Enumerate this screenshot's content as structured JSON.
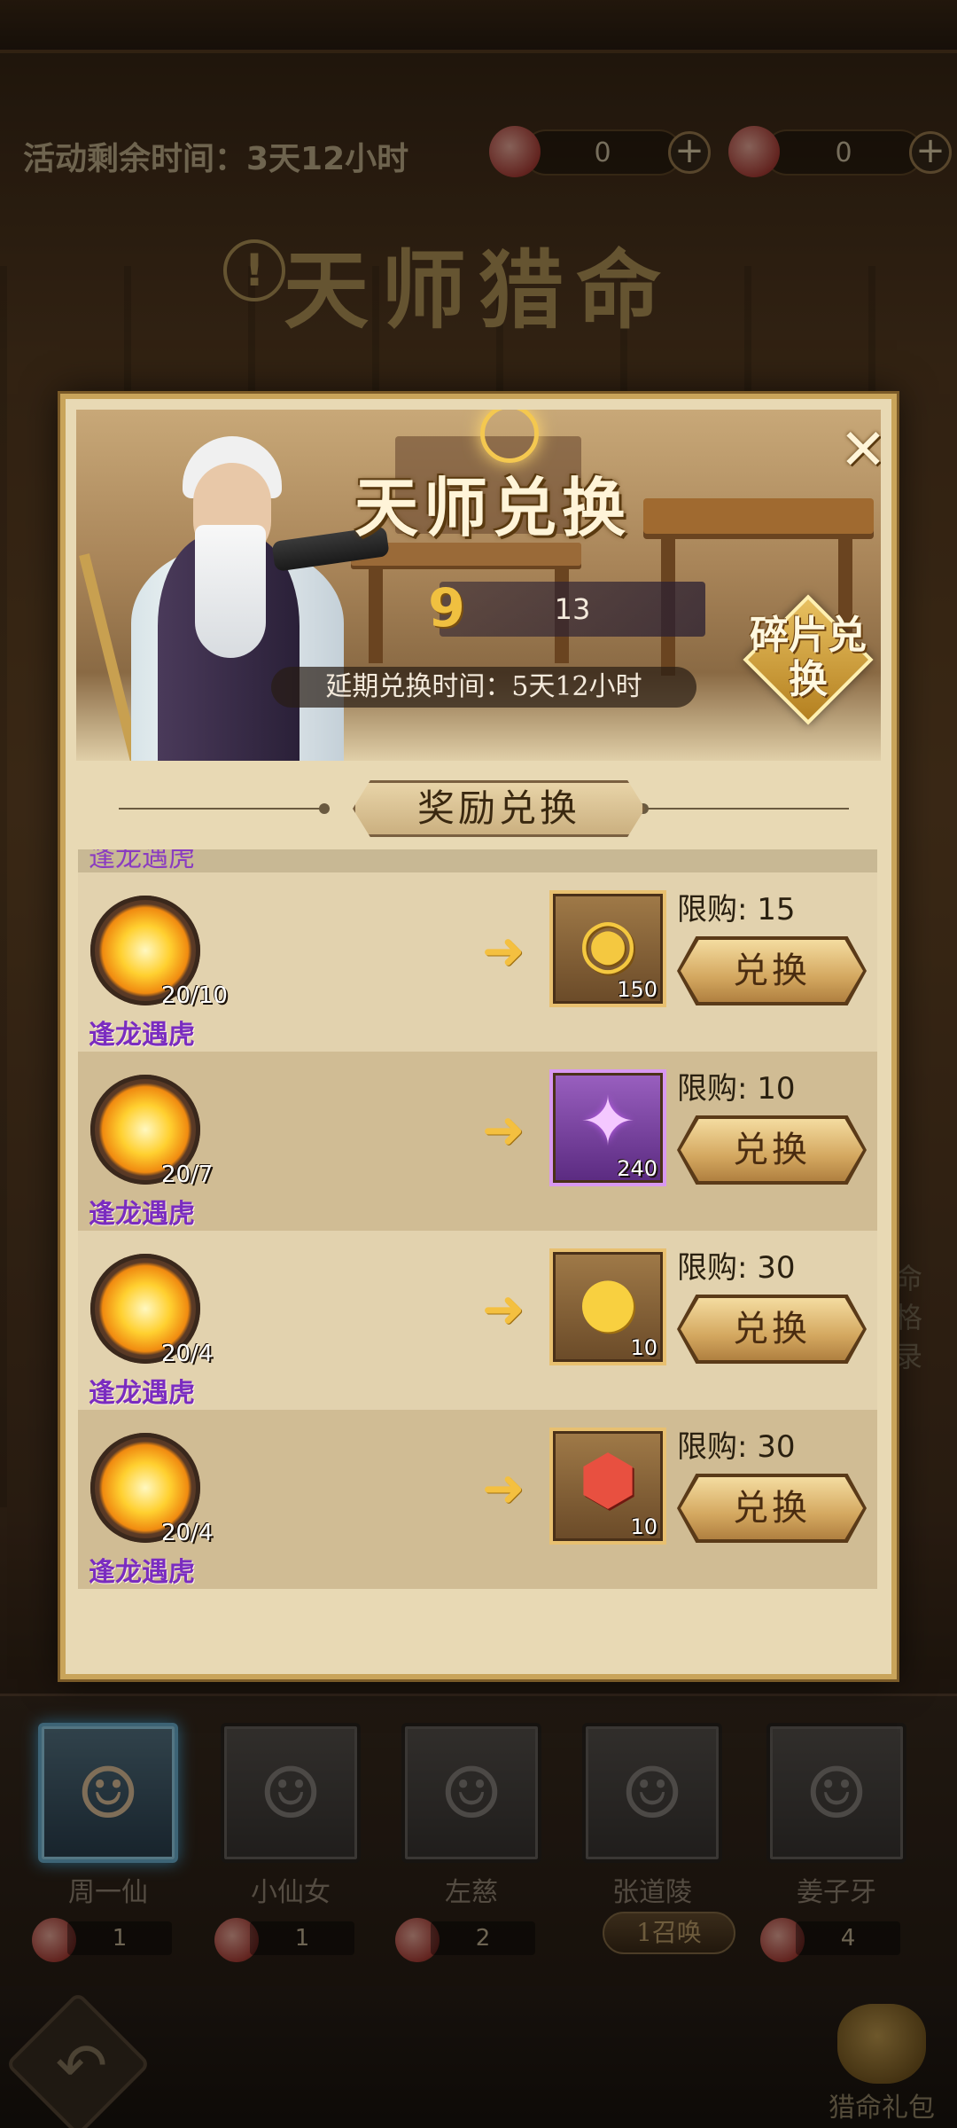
{
  "event": {
    "remaining_label": "活动剩余时间：3天12小时",
    "title": "天师猎命",
    "currency_a": "0",
    "currency_b": "0"
  },
  "modal": {
    "title": "天师兑换",
    "fragment_count": "13",
    "extend_time": "延期兑换时间：5天12小时",
    "shard_exchange_label": "碎片兑换",
    "section_title": "奖励兑换",
    "partial_row_name": "逢龙遇虎",
    "rows": [
      {
        "cost_name": "逢龙遇虎",
        "cost_count": "20/10",
        "reward_qty": "150",
        "reward_icon": "coin-ring-icon",
        "limit": "限购: 15",
        "button": "兑换"
      },
      {
        "cost_name": "逢龙遇虎",
        "cost_count": "20/7",
        "reward_qty": "240",
        "reward_icon": "purple-star-icon",
        "limit": "限购: 10",
        "button": "兑换"
      },
      {
        "cost_name": "逢龙遇虎",
        "cost_count": "20/4",
        "reward_qty": "10",
        "reward_icon": "gold-cloud-coin-icon",
        "limit": "限购: 30",
        "button": "兑换"
      },
      {
        "cost_name": "逢龙遇虎",
        "cost_count": "20/4",
        "reward_qty": "10",
        "reward_icon": "red-swirl-gem-icon",
        "limit": "限购: 30",
        "button": "兑换"
      }
    ]
  },
  "heroes": [
    {
      "name": "周一仙",
      "count": "1"
    },
    {
      "name": "小仙女",
      "count": "1"
    },
    {
      "name": "左慈",
      "count": "2"
    },
    {
      "name": "张道陵",
      "count": ""
    },
    {
      "name": "姜子牙",
      "count": "4"
    }
  ],
  "summon_label": "1召唤",
  "gift_pack_label": "猎命礼包",
  "side_record_label": "命格录",
  "colors": {
    "frame_gold": "#c9a45a",
    "purple_name": "#7a2cc0",
    "panel_bg": "#e8d9b4"
  }
}
